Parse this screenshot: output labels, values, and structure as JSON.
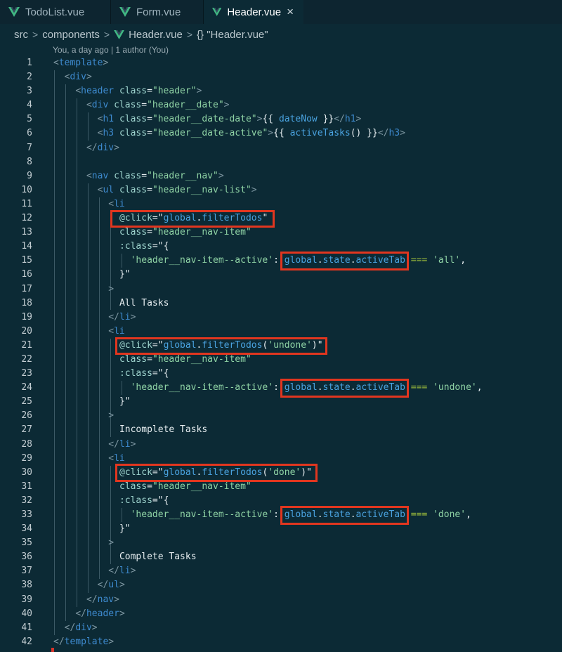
{
  "tabs": [
    {
      "label": "TodoList.vue",
      "active": false,
      "icon": "vue-icon"
    },
    {
      "label": "Form.vue",
      "active": false,
      "icon": "vue-icon"
    },
    {
      "label": "Header.vue",
      "active": true,
      "icon": "vue-icon",
      "close": "×"
    }
  ],
  "breadcrumb": {
    "parts": [
      "src",
      "components",
      "Header.vue",
      "{} \"Header.vue\""
    ],
    "separator": ">"
  },
  "blame": "You, a day ago | 1 author (You)",
  "colors": {
    "background": "#0c2a35",
    "tag": "#3e8bd0",
    "attribute": "#9fd5cf",
    "string": "#8fd3a5",
    "variable": "#4aa3e0",
    "highlight_red": "#e2361f",
    "highlight_blue": "#7aa6c9",
    "vue_green": "#41b883"
  },
  "code_lines": [
    "<template>",
    "  <div>",
    "    <header class=\"header\">",
    "      <div class=\"header__date\">",
    "        <h1 class=\"header__date-date\">{{ dateNow }}</h1>",
    "        <h3 class=\"header__date-active\">{{ activeTasks() }}</h3>",
    "      </div>",
    "",
    "      <nav class=\"header__nav\">",
    "        <ul class=\"header__nav-list\">",
    "          <li",
    "            @click=\"global.filterTodos\"",
    "            class=\"header__nav-item\"",
    "            :class=\"{",
    "              'header__nav-item--active': global.state.activeTab === 'all',",
    "            }\"",
    "          >",
    "            All Tasks",
    "          </li>",
    "          <li",
    "            @click=\"global.filterTodos('undone')\"",
    "            class=\"header__nav-item\"",
    "            :class=\"{",
    "              'header__nav-item--active': global.state.activeTab === 'undone',",
    "            }\"",
    "          >",
    "            Incomplete Tasks",
    "          </li>",
    "          <li",
    "            @click=\"global.filterTodos('done')\"",
    "            class=\"header__nav-item\"",
    "            :class=\"{",
    "              'header__nav-item--active': global.state.activeTab === 'done',",
    "            }\"",
    "          >",
    "            Complete Tasks",
    "          </li>",
    "        </ul>",
    "      </nav>",
    "    </header>",
    "  </div>",
    "</template>"
  ]
}
